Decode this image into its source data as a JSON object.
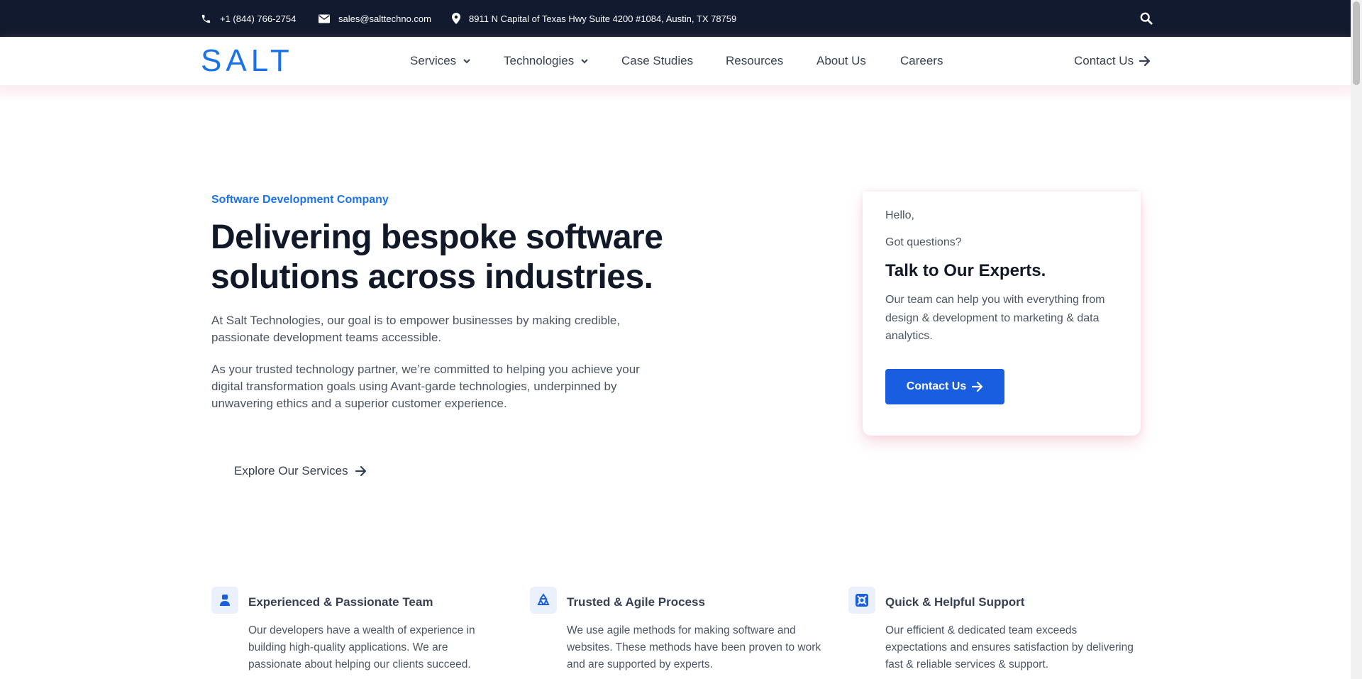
{
  "topbar": {
    "phone": "+1 (844) 766-2754",
    "email": "sales@salttechno.com",
    "address": "8911 N Capital of Texas Hwy Suite 4200 #1084, Austin, TX 78759",
    "icons": [
      "phone-icon",
      "mail-icon",
      "location-pin-icon",
      "search-icon"
    ]
  },
  "nav": {
    "logo": "SALT",
    "services": "Services",
    "technologies": "Technologies",
    "case_studies": "Case Studies",
    "resources": "Resources",
    "about": "About Us",
    "careers": "Careers",
    "contact": "Contact Us"
  },
  "hero": {
    "eyebrow": "Software Development Company",
    "headline": "Delivering bespoke software solutions across industries.",
    "para1": "At Salt Technologies, our goal is to empower businesses by making credible, passionate development teams accessible.",
    "para2": "As your trusted technology partner, we’re committed to helping you achieve your digital transformation goals using Avant-garde technologies, underpinned by unwavering ethics and a superior customer experience.",
    "explore": "Explore Our Services"
  },
  "card": {
    "hello": "Hello,",
    "question": "Got questions?",
    "title": "Talk to Our Experts.",
    "body": "Our team can help you with everything from design & development to marketing & data analytics.",
    "button": "Contact Us"
  },
  "features": [
    {
      "icon": "team-member-icon",
      "title": "Experienced & Passionate Team",
      "desc": "Our developers have a wealth of experience in building high-quality applications. We are passionate about helping our clients succeed."
    },
    {
      "icon": "recycle-process-icon",
      "title": "Trusted & Agile Process",
      "desc": "We use agile methods for making software and websites. These methods have been proven to work and are supported by experts."
    },
    {
      "icon": "support-lifebuoy-icon",
      "title": "Quick & Helpful Support",
      "desc": "Our efficient & dedicated team exceeds expectations and ensures satisfaction by delivering fast & reliable services & support."
    }
  ],
  "colors": {
    "topbar_bg": "#111a2e",
    "brand_blue": "#1a73e8",
    "button_blue": "#1a5ee0",
    "heading": "#111827",
    "body_text": "#4b5563",
    "accent_pink_shadow": "#e79eb2"
  }
}
